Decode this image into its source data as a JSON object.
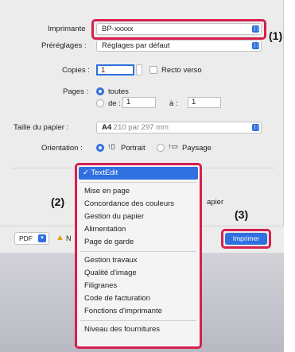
{
  "printer": {
    "label": "Imprimante",
    "value": "BP-xxxxx"
  },
  "presets": {
    "label": "Préréglages :",
    "value": "Réglages par défaut"
  },
  "copies": {
    "label": "Copies :",
    "value": "1",
    "duplex_label": "Recto verso"
  },
  "pages": {
    "label": "Pages :",
    "all_label": "toutes",
    "from_label": "de :",
    "from_value": "1",
    "to_label": "à :",
    "to_value": "1"
  },
  "paper": {
    "label": "Taille du papier :",
    "value": "A4",
    "size_text": "210 par 297 mm"
  },
  "orientation": {
    "label": "Orientation :",
    "portrait": "Portrait",
    "landscape": "Paysage"
  },
  "partial": {
    "left_text": "In",
    "right_text": "apier"
  },
  "menu": {
    "selected": "✓ TextEdit",
    "group1": [
      "Mise en page",
      "Concordance des couleurs",
      "Gestion du papier",
      "Alimentation",
      "Page de garde"
    ],
    "group2": [
      "Gestion travaux",
      "Qualité d'image",
      "Filigranes",
      "Code de facturation",
      "Fonctions d'imprimante"
    ],
    "group3": [
      "Niveau des fournitures"
    ]
  },
  "bottom": {
    "pdf_label": "PDF",
    "print_label": "Imprimer"
  },
  "callouts": {
    "c1": "(1)",
    "c2": "(2)",
    "c3": "(3)"
  },
  "colors": {
    "accent": "#2f6fe0",
    "highlight": "#d6204f"
  }
}
